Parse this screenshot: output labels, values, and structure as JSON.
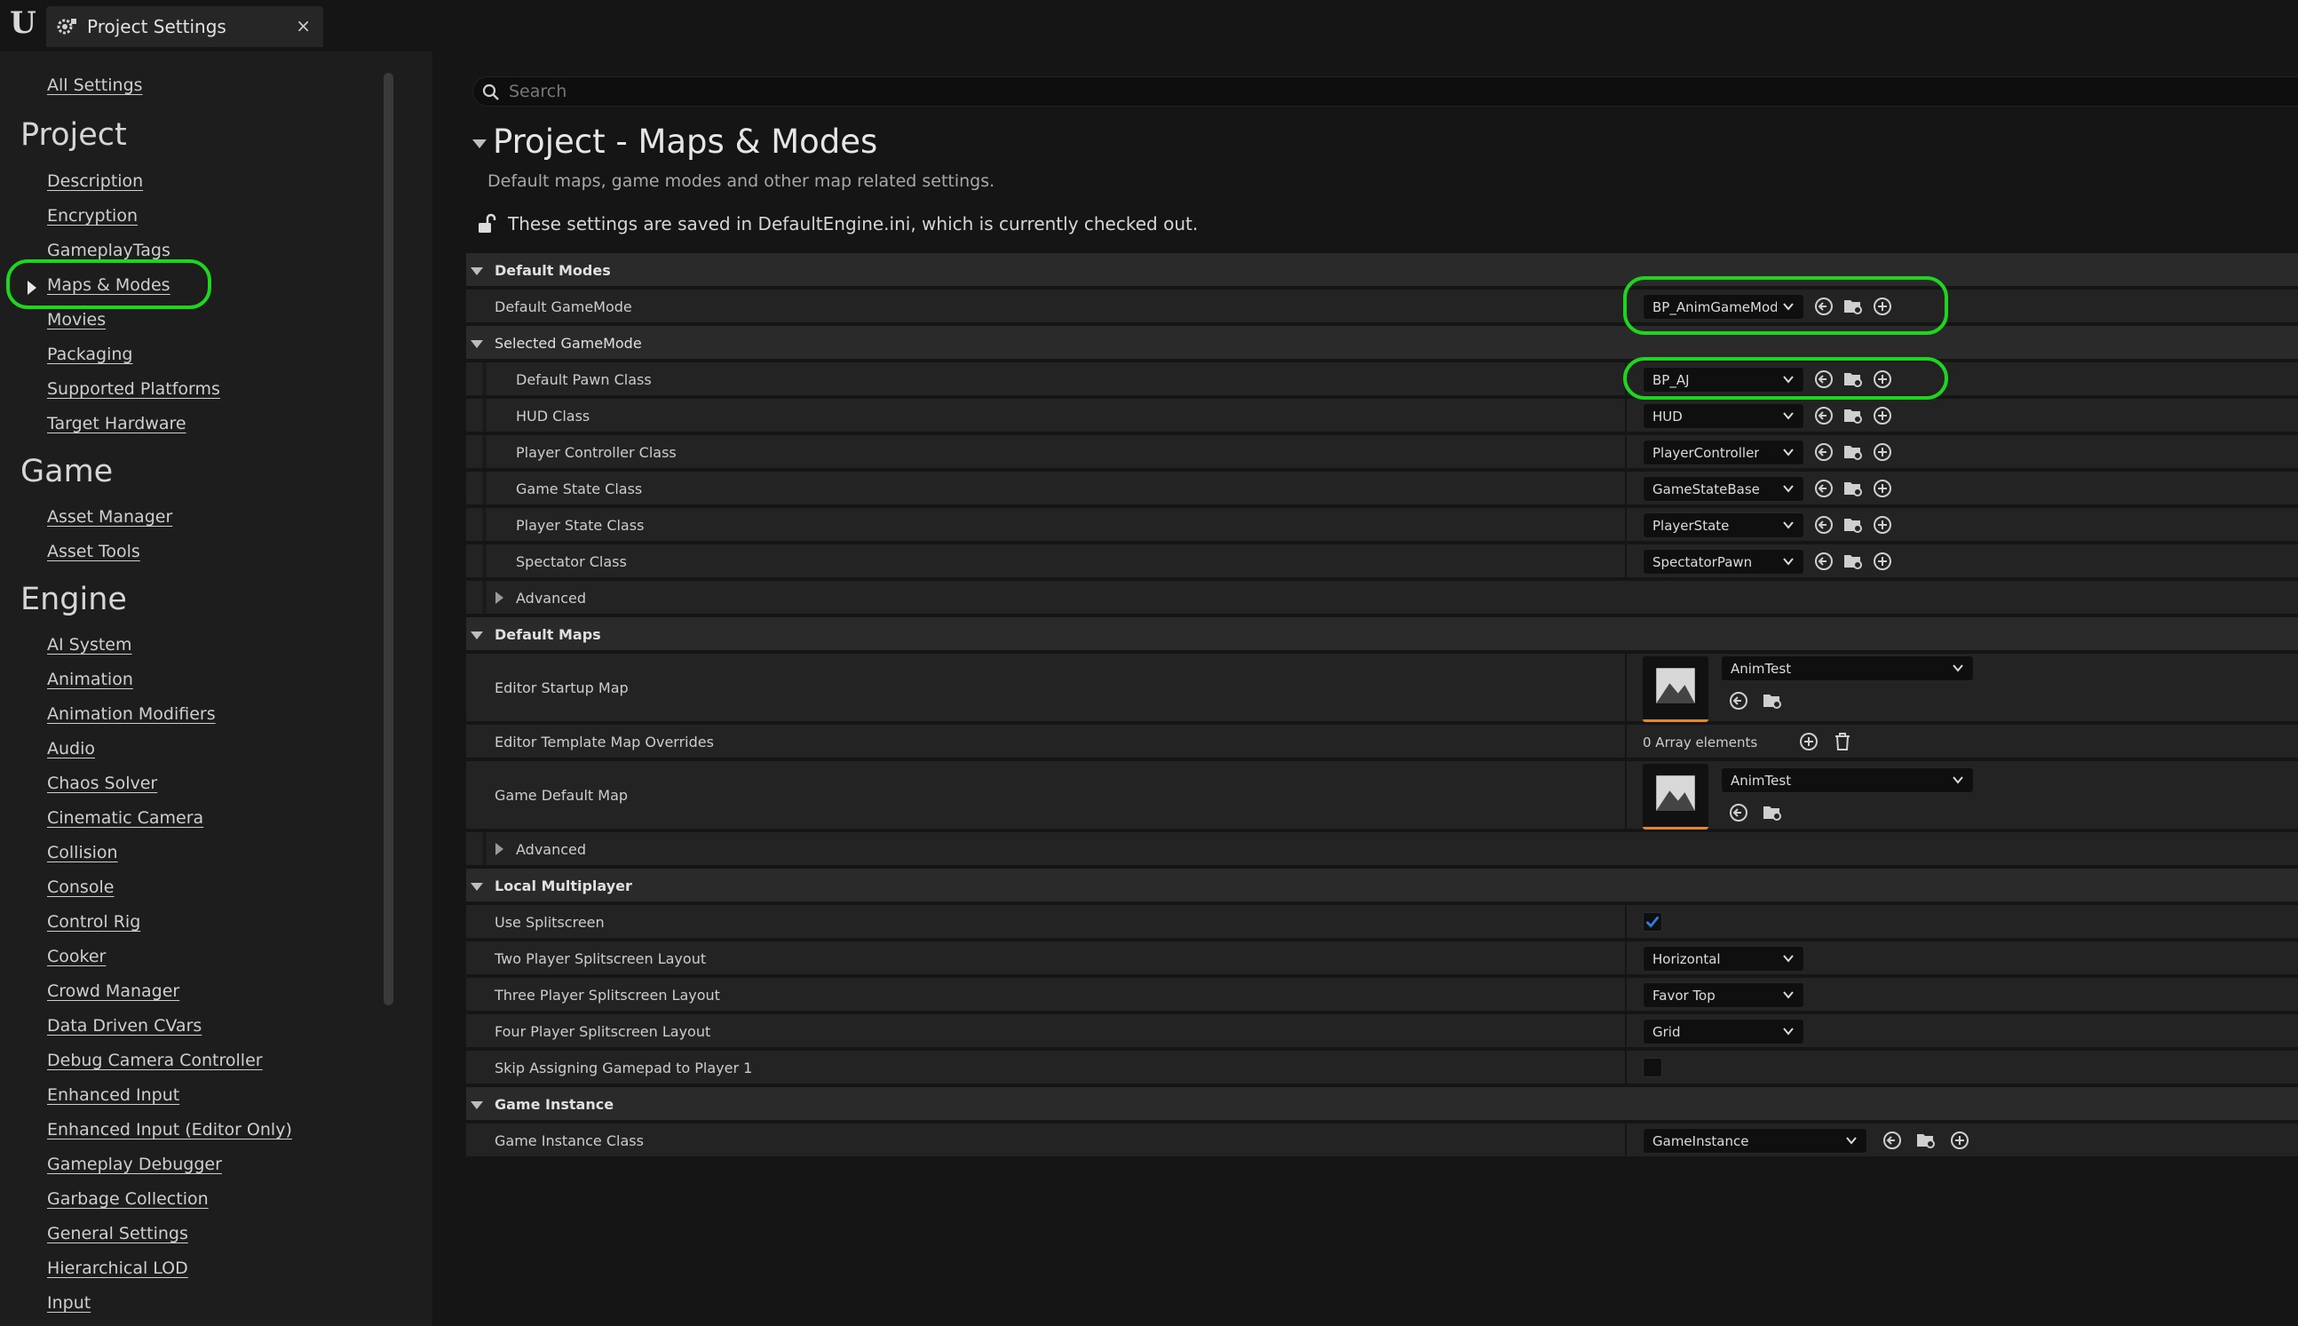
{
  "window": {
    "tab_title": "Project Settings",
    "close_glyph": "×",
    "logo_glyph": "U"
  },
  "sidebar": {
    "all_settings": "All Settings",
    "categories": [
      {
        "title": "Project",
        "items": [
          "Description",
          "Encryption",
          "GameplayTags",
          "Maps & Modes",
          "Movies",
          "Packaging",
          "Supported Platforms",
          "Target Hardware"
        ]
      },
      {
        "title": "Game",
        "items": [
          "Asset Manager",
          "Asset Tools"
        ]
      },
      {
        "title": "Engine",
        "items": [
          "AI System",
          "Animation",
          "Animation Modifiers",
          "Audio",
          "Chaos Solver",
          "Cinematic Camera",
          "Collision",
          "Console",
          "Control Rig",
          "Cooker",
          "Crowd Manager",
          "Data Driven CVars",
          "Debug Camera Controller",
          "Enhanced Input",
          "Enhanced Input (Editor Only)",
          "Gameplay Debugger",
          "Garbage Collection",
          "General Settings",
          "Hierarchical LOD",
          "Input"
        ]
      }
    ],
    "selected": "Maps & Modes"
  },
  "search": {
    "placeholder": "Search",
    "value": ""
  },
  "page": {
    "title": "Project - Maps & Modes",
    "subtitle": "Default maps, game modes and other map related settings.",
    "save_note": "These settings are saved in DefaultEngine.ini, which is currently checked out."
  },
  "sections": {
    "default_modes": {
      "title": "Default Modes",
      "default_gamemode": {
        "label": "Default GameMode",
        "value": "BP_AnimGameMode"
      },
      "selected_gamemode": "Selected GameMode",
      "pawn": {
        "label": "Default Pawn Class",
        "value": "BP_AJ"
      },
      "hud": {
        "label": "HUD Class",
        "value": "HUD"
      },
      "controller": {
        "label": "Player Controller Class",
        "value": "PlayerController"
      },
      "game_state": {
        "label": "Game State Class",
        "value": "GameStateBase"
      },
      "player_state": {
        "label": "Player State Class",
        "value": "PlayerState"
      },
      "spectator": {
        "label": "Spectator Class",
        "value": "SpectatorPawn"
      },
      "advanced": "Advanced"
    },
    "default_maps": {
      "title": "Default Maps",
      "editor_startup": {
        "label": "Editor Startup Map",
        "value": "AnimTest"
      },
      "template_overrides": {
        "label": "Editor Template Map Overrides",
        "value": "0 Array elements"
      },
      "game_default": {
        "label": "Game Default Map",
        "value": "AnimTest"
      },
      "advanced": "Advanced"
    },
    "local_multiplayer": {
      "title": "Local Multiplayer",
      "use_splitscreen": {
        "label": "Use Splitscreen",
        "checked": true
      },
      "two_player": {
        "label": "Two Player Splitscreen Layout",
        "value": "Horizontal"
      },
      "three_player": {
        "label": "Three Player Splitscreen Layout",
        "value": "Favor Top"
      },
      "four_player": {
        "label": "Four Player Splitscreen Layout",
        "value": "Grid"
      },
      "skip_gamepad": {
        "label": "Skip Assigning Gamepad to Player 1",
        "checked": false
      }
    },
    "game_instance": {
      "title": "Game Instance",
      "class": {
        "label": "Game Instance Class",
        "value": "GameInstance"
      }
    }
  },
  "icons": {
    "reset": "back-arrow-icon",
    "browse": "folder-browse-icon",
    "add": "plus-circle-icon",
    "delete": "trash-icon",
    "lock": "unlocked-icon"
  },
  "colors": {
    "highlight": "#1fd51f",
    "checkbox_check": "#2f7fe0",
    "thumb_accent": "#e2892b"
  }
}
